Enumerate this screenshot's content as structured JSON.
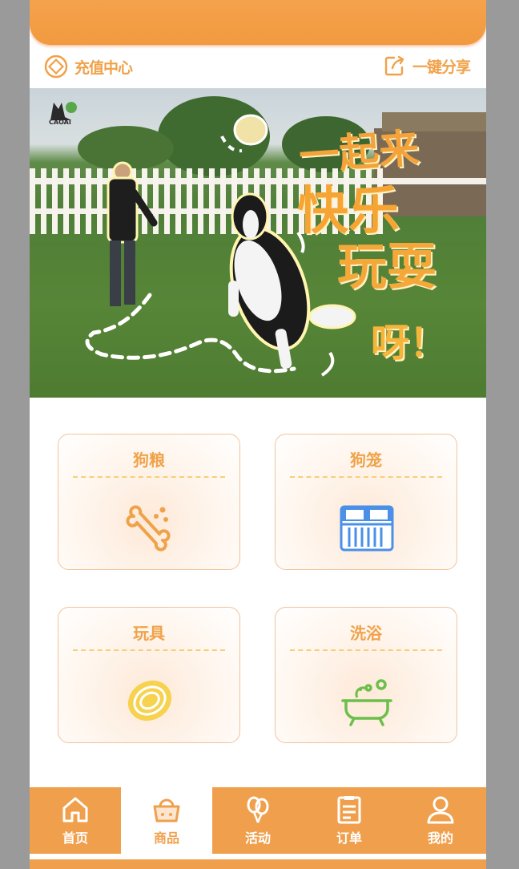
{
  "toolbar": {
    "recharge_label": "充值中心",
    "share_label": "一键分享"
  },
  "hero": {
    "logo_text": "CAOAI",
    "line1": "一起来",
    "line2": "快乐",
    "line3": "玩耍",
    "line4": "呀！"
  },
  "categories": [
    {
      "label": "狗粮",
      "icon": "bone-icon",
      "color": "#f0a24a"
    },
    {
      "label": "狗笼",
      "icon": "cage-icon",
      "color": "#4a8fe8"
    },
    {
      "label": "玩具",
      "icon": "frisbee-icon",
      "color": "#f2c24a"
    },
    {
      "label": "洗浴",
      "icon": "bathtub-icon",
      "color": "#6bbf4a"
    }
  ],
  "tabs": [
    {
      "label": "首页",
      "icon": "home-icon",
      "active": false
    },
    {
      "label": "商品",
      "icon": "shopping-basket-icon",
      "active": true
    },
    {
      "label": "活动",
      "icon": "balloons-icon",
      "active": false
    },
    {
      "label": "订单",
      "icon": "order-list-icon",
      "active": false
    },
    {
      "label": "我的",
      "icon": "user-icon",
      "active": false
    }
  ],
  "colors": {
    "accent": "#f0a04d",
    "accent_text": "#f0a24a",
    "card_border": "#f2c39a"
  }
}
